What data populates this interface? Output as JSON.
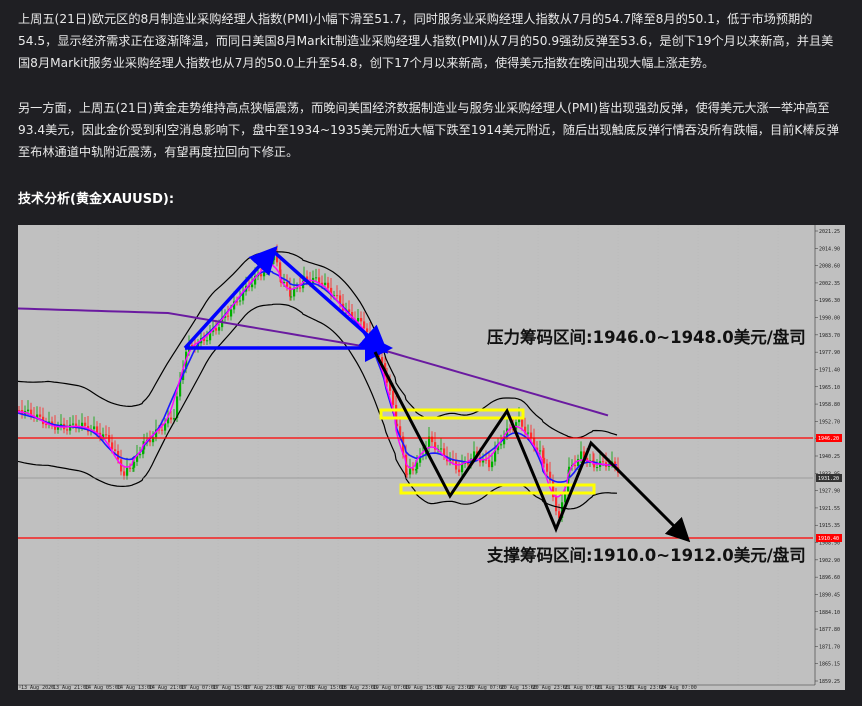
{
  "article": {
    "paragraph_1": "上周五(21日)欧元区的8月制造业采购经理人指数(PMI)小幅下滑至51.7，同时服务业采购经理人指数从7月的54.7降至8月的50.1，低于市场预期的54.5，显示经济需求正在逐渐降温，而同日美国8月Markit制造业采购经理人指数(PMI)从7月的50.9强劲反弹至53.6，是创下19个月以来新高，并且美国8月Markit服务业采购经理人指数也从7月的50.0上升至54.8，创下17个月以来新高，使得美元指数在晚间出现大幅上涨走势。",
    "paragraph_2": "另一方面，上周五(21日)黄金走势维持高点狭幅震荡，而晚间美国经济数据制造业与服务业采购经理人(PMI)皆出现强劲反弹，使得美元大涨一举冲高至93.4美元，因此金价受到利空消息影响下，盘中至1934~1935美元附近大幅下跌至1914美元附近，随后出现触底反弹行情吞没所有跌幅，目前K棒反弹至布林通道中轨附近震荡，有望再度拉回向下修正。",
    "section_heading": "技术分析(黄金XAUUSD):"
  },
  "chart": {
    "resistance_label": "压力筹码区间:1946.0~1948.0美元/盘司",
    "support_label": "支撑筹码区间:1910.0~1912.0美元/盘司",
    "price_scale": [
      "2021.25",
      "2014.90",
      "2008.60",
      "2002.35",
      "1996.30",
      "1990.00",
      "1983.70",
      "1977.90",
      "1971.40",
      "1965.10",
      "1958.80",
      "1952.70",
      "1946.20",
      "1940.25",
      "1933.95",
      "1927.90",
      "1921.55",
      "1915.35",
      "1908.90",
      "1902.90",
      "1896.60",
      "1890.45",
      "1884.10",
      "1877.80",
      "1871.70",
      "1865.15",
      "1859.25"
    ],
    "time_scale": [
      "13 Aug 2020",
      "13 Aug 21:00",
      "14 Aug 05:00",
      "14 Aug 13:00",
      "14 Aug 21:00",
      "17 Aug 07:00",
      "17 Aug 15:00",
      "17 Aug 23:00",
      "18 Aug 07:00",
      "18 Aug 15:00",
      "18 Aug 23:00",
      "19 Aug 07:00",
      "19 Aug 15:00",
      "19 Aug 23:00",
      "20 Aug 07:00",
      "20 Aug 15:00",
      "20 Aug 23:00",
      "21 Aug 07:00",
      "21 Aug 15:00",
      "21 Aug 23:00",
      "24 Aug 07:00"
    ],
    "red_line_labels": [
      "1946.20",
      "1910.40"
    ],
    "current_price_label": "1931.20",
    "colors": {
      "background": "#c0c0c0",
      "support_resistance": "#ff0000",
      "zone_box": "#ffff00",
      "trend_arrow": "#0000ff",
      "projection_arrow": "#000000",
      "bollinger": "#000000",
      "ma_long": "#6a1aa0",
      "ma_blue": "#1a1aff",
      "ma_magenta": "#ff00ff"
    }
  }
}
